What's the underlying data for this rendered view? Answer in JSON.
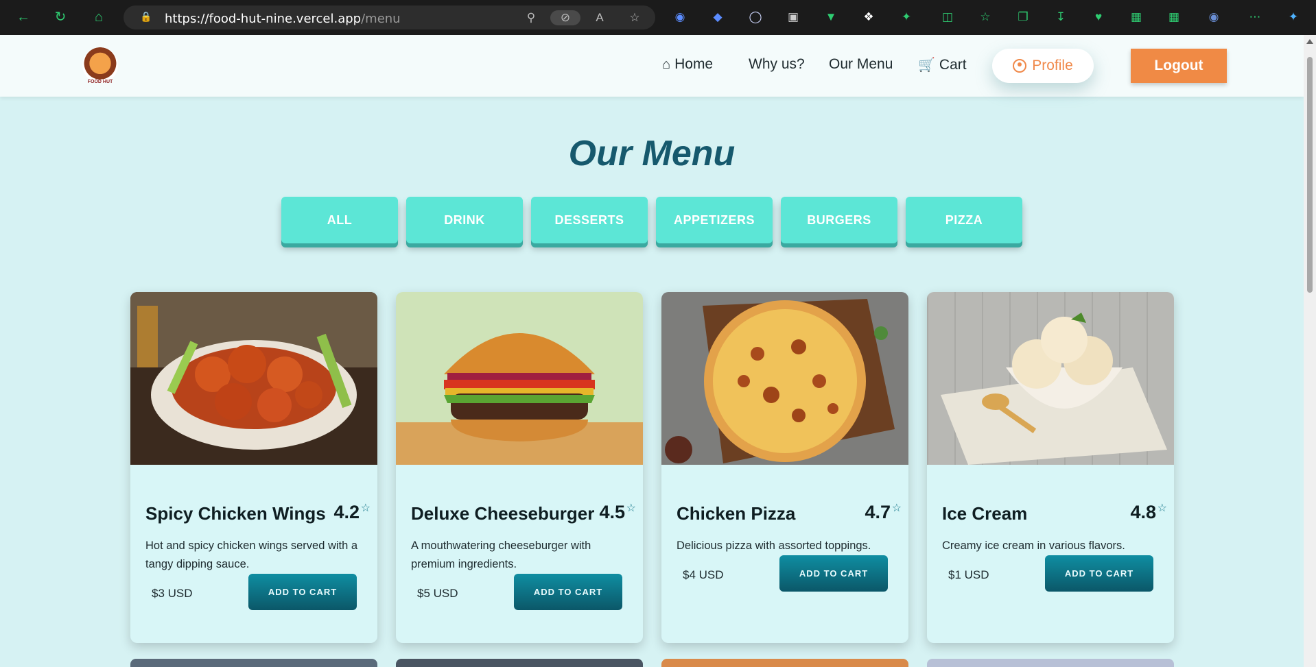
{
  "browser": {
    "url_host": "https://food-hut-nine.vercel.app",
    "url_path": "/menu"
  },
  "header": {
    "logo_text": "FOOD HUT",
    "nav": [
      {
        "label": "Home",
        "icon": "home-icon"
      },
      {
        "label": "Why us?"
      },
      {
        "label": "Our Menu"
      },
      {
        "label": "Cart",
        "icon": "cart-icon"
      }
    ],
    "profile_label": "Profile",
    "logout_label": "Logout"
  },
  "main": {
    "title": "Our Menu",
    "filters": [
      "ALL",
      "DRINK",
      "DESSERTS",
      "APPETIZERS",
      "BURGERS",
      "PIZZA"
    ],
    "items": [
      {
        "name": "Spicy Chicken Wings",
        "rating": "4.2",
        "description": "Hot and spicy chicken wings served with a tangy dipping sauce.",
        "price": "$3 USD",
        "button": "ADD TO CART"
      },
      {
        "name": "Deluxe Cheeseburger",
        "rating": "4.5",
        "description": "A mouthwatering cheeseburger with premium ingredients.",
        "price": "$5 USD",
        "button": "ADD TO CART"
      },
      {
        "name": "Chicken Pizza",
        "rating": "4.7",
        "description": "Delicious pizza with assorted toppings.",
        "price": "$4 USD",
        "button": "ADD TO CART"
      },
      {
        "name": "Ice Cream",
        "rating": "4.8",
        "description": "Creamy ice cream in various flavors.",
        "price": "$1 USD",
        "button": "ADD TO CART"
      }
    ]
  },
  "colors": {
    "accent_orange": "#f08a45",
    "filter_teal": "#5ce6d6",
    "title_teal": "#16596d",
    "button_teal": "#0b5768"
  }
}
